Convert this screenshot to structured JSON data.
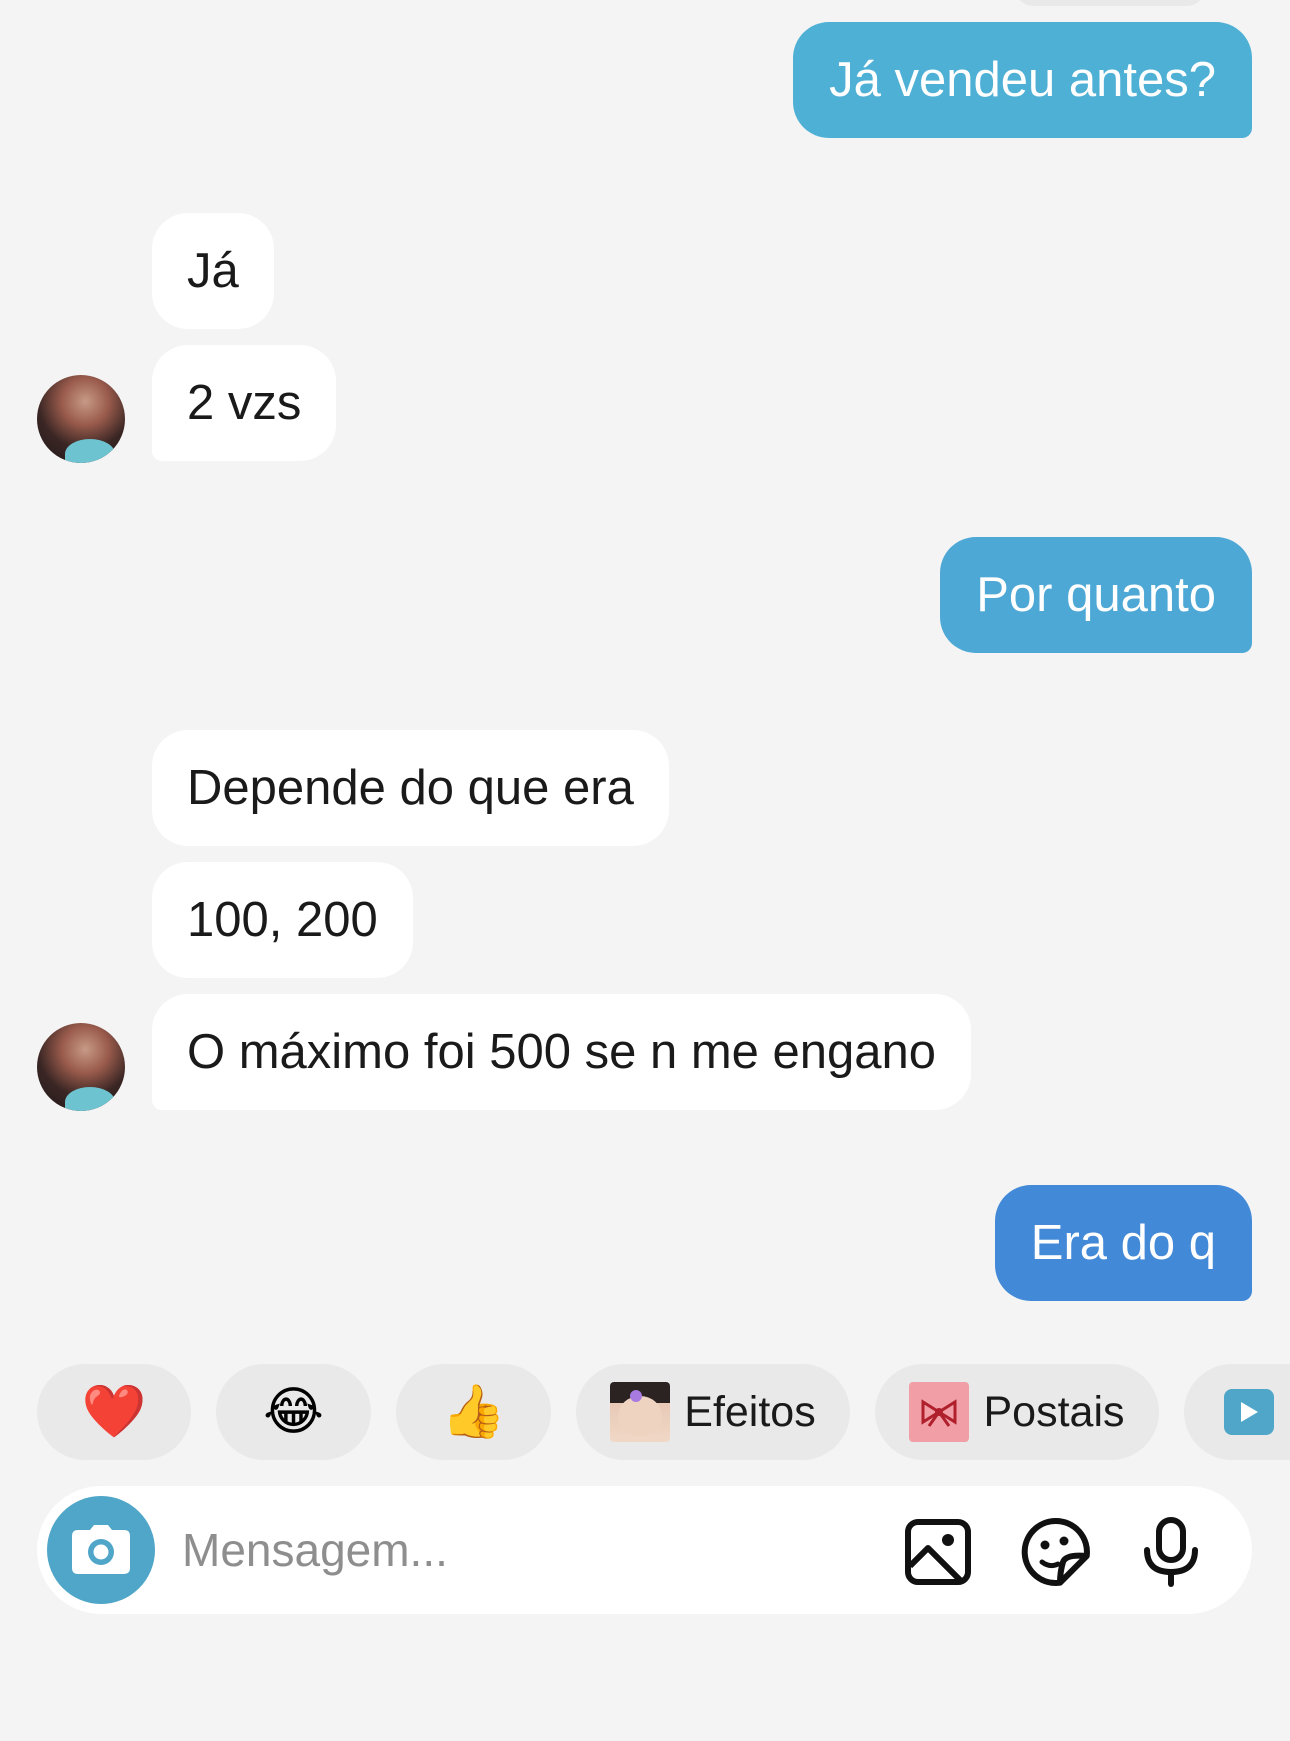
{
  "messages": [
    {
      "direction": "out",
      "text": "Já vendeu antes?",
      "color": "#4fb0d6"
    },
    {
      "direction": "in",
      "text": "Já"
    },
    {
      "direction": "in",
      "text": "2 vzs"
    },
    {
      "direction": "out",
      "text": "Por quanto",
      "color": "#4da8d6"
    },
    {
      "direction": "in",
      "text": "Depende do que era"
    },
    {
      "direction": "in",
      "text": "100, 200"
    },
    {
      "direction": "in",
      "text": "O máximo foi 500 se n me engano"
    },
    {
      "direction": "out",
      "text": "Era do q",
      "color": "#4289d8"
    }
  ],
  "quick_reactions": [
    {
      "emoji": "❤️",
      "icon": "heart-icon"
    },
    {
      "emoji": "😂",
      "icon": "laughing-face-icon"
    },
    {
      "emoji": "👍",
      "icon": "thumbs-up-icon"
    }
  ],
  "chips": {
    "effects_label": "Efeitos",
    "postcards_label": "Postais"
  },
  "composer": {
    "placeholder": "Mensagem...",
    "icons": [
      "camera-icon",
      "gallery-icon",
      "sticker-icon",
      "microphone-icon"
    ]
  },
  "colors": {
    "background": "#f4f4f4",
    "incoming_bubble": "#ffffff",
    "accent": "#4fa6c8"
  }
}
